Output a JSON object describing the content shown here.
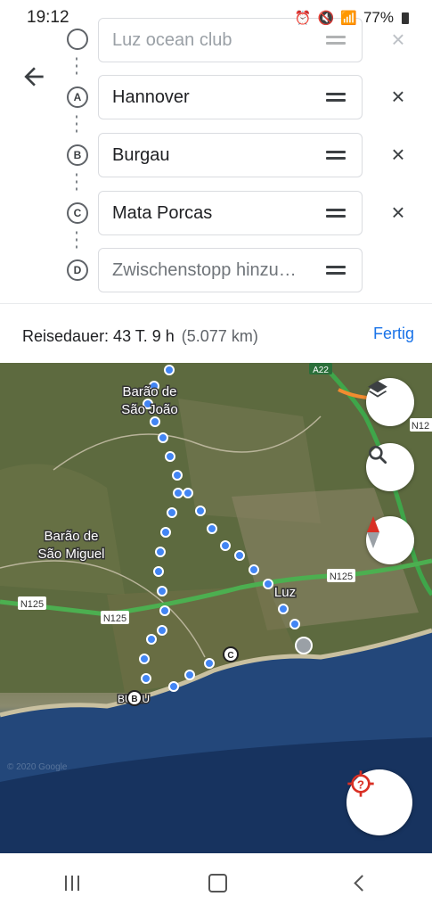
{
  "status_bar": {
    "time": "19:12",
    "battery_percent": "77%"
  },
  "stops": [
    {
      "marker": "",
      "name": "Luz ocean club",
      "removable": true
    },
    {
      "marker": "A",
      "name": "Hannover",
      "removable": true
    },
    {
      "marker": "B",
      "name": "Burgau",
      "removable": true
    },
    {
      "marker": "C",
      "name": "Mata Porcas",
      "removable": true
    }
  ],
  "add_stop": {
    "marker": "D",
    "placeholder": "Zwischenstopp hinzu…"
  },
  "summary": {
    "label": "Reisedauer: 43 T. 9 h",
    "distance": "(5.077 km)",
    "done": "Fertig"
  },
  "map": {
    "places": {
      "barao_sao_joao": [
        "Barão de",
        "São João"
      ],
      "barao_sao_miguel": [
        "Barão de",
        "São Miguel"
      ],
      "luz": "Luz",
      "burgau": "BU  AU"
    },
    "roads": {
      "a22": "A22",
      "n125_left": "N125",
      "n125_mid": "N125",
      "n125_right": "N125",
      "n125_far": "N12"
    },
    "waypoint_labels": {
      "b": "B",
      "c": "C"
    },
    "attribution": "© 2020 Google",
    "colors": {
      "route_dots": "#4285f4",
      "highway": "#4caf50",
      "compass_red": "#d93025",
      "locate_red": "#d93025"
    }
  },
  "controls": {
    "layers": "layers-icon",
    "search": "search-icon",
    "compass": "compass-icon",
    "locate": "my-location-icon"
  }
}
